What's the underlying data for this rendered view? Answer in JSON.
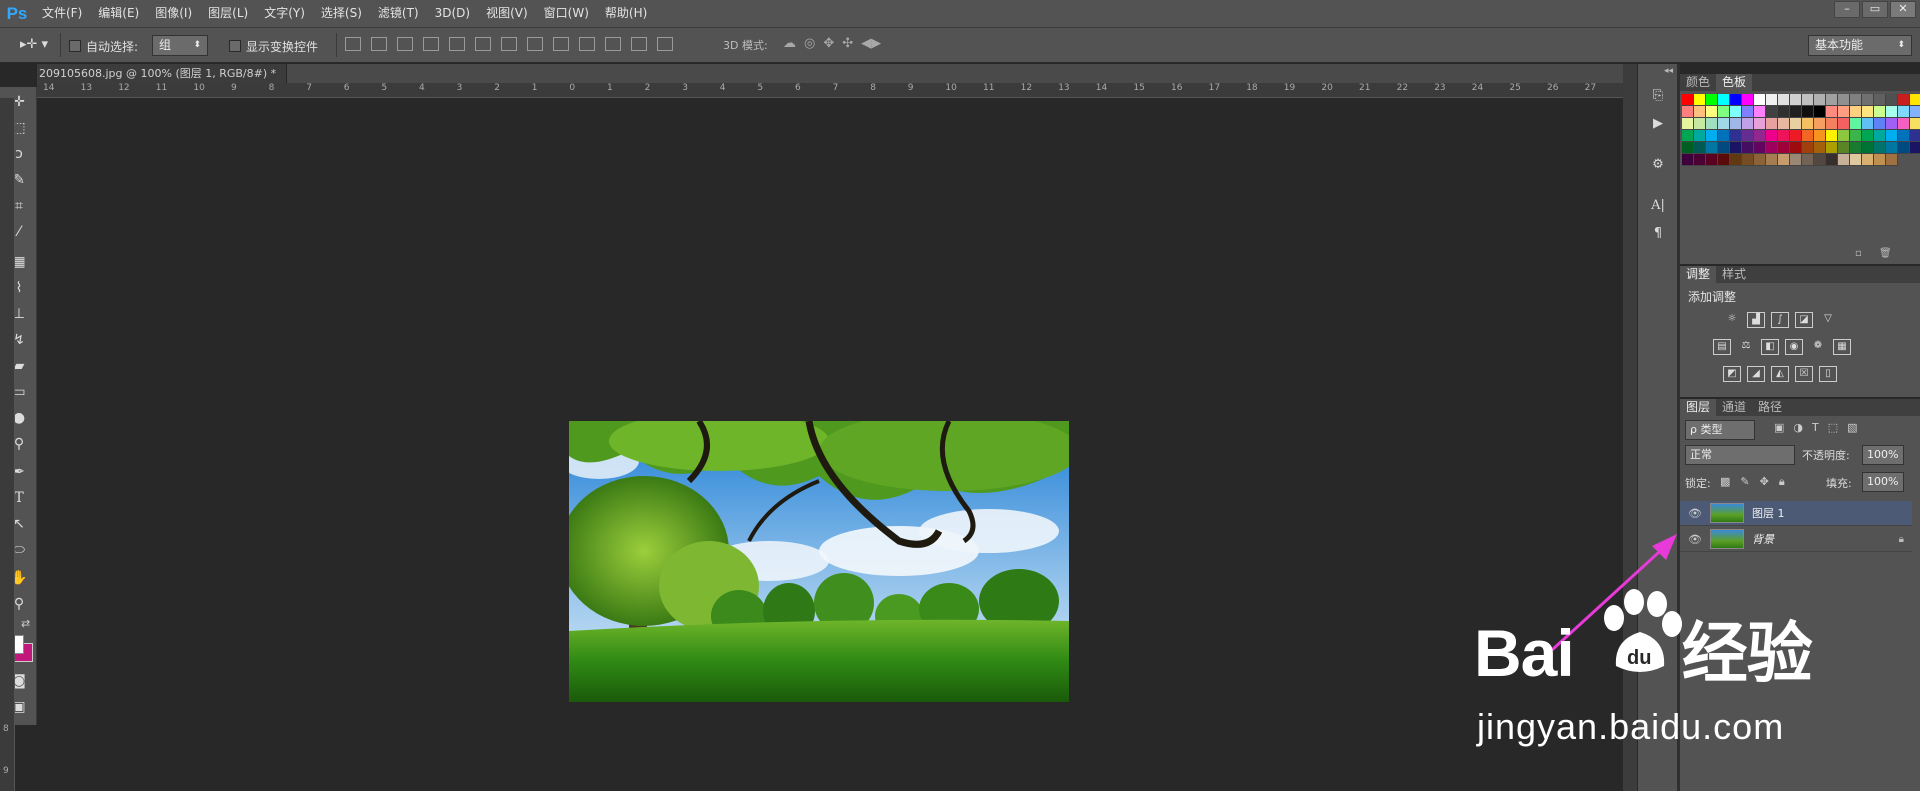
{
  "app": {
    "logo": "Ps"
  },
  "menu": [
    "文件(F)",
    "编辑(E)",
    "图像(I)",
    "图层(L)",
    "文字(Y)",
    "选择(S)",
    "滤镜(T)",
    "3D(D)",
    "视图(V)",
    "窗口(W)",
    "帮助(H)"
  ],
  "window_controls": [
    "–",
    "▭",
    "✕"
  ],
  "options": {
    "auto_select_label": "自动选择:",
    "auto_select_value": "组",
    "show_transform_label": "显示变换控件",
    "mode_3d_label": "3D 模式:",
    "workspace": "基本功能"
  },
  "document": {
    "tab_title": "209105608.jpg @ 100% (图层 1, RGB/8#) *",
    "tab_close": "×"
  },
  "ruler": {
    "h_labels": [
      "14",
      "13",
      "12",
      "11",
      "10",
      "9",
      "8",
      "7",
      "6",
      "5",
      "4",
      "3",
      "2",
      "1",
      "0",
      "1",
      "2",
      "3",
      "4",
      "5",
      "6",
      "7",
      "8",
      "9",
      "10",
      "11",
      "12",
      "13",
      "14",
      "15",
      "16",
      "17",
      "18",
      "19",
      "20",
      "21",
      "22",
      "23",
      "24",
      "25",
      "26",
      "27"
    ],
    "v_labels": [
      "8",
      "9"
    ]
  },
  "panels": {
    "color_tabs": [
      "颜色",
      "色板"
    ],
    "adjust_tabs": [
      "调整",
      "样式"
    ],
    "add_adjustment": "添加调整",
    "layers_tabs": [
      "图层",
      "通道",
      "路径"
    ],
    "filter_kind": "ρ 类型",
    "blend_mode": "正常",
    "opacity_label": "不透明度:",
    "opacity_value": "100%",
    "lock_label": "锁定:",
    "fill_label": "填充:",
    "fill_value": "100%",
    "layers": [
      {
        "name": "图层 1",
        "selected": true,
        "locked": false
      },
      {
        "name": "背景",
        "selected": false,
        "locked": true
      }
    ]
  },
  "swatches": [
    "#ff0000",
    "#ffff00",
    "#00ff00",
    "#00ffff",
    "#0000ff",
    "#ff00ff",
    "#ffffff",
    "#f0f0f0",
    "#e0e0e0",
    "#d0d0d0",
    "#c0c0c0",
    "#b0b0b0",
    "#a0a0a0",
    "#909090",
    "#808080",
    "#707070",
    "#606060",
    "#505050",
    "#c81e1e",
    "#ffe600",
    "#ffe600",
    "#ff7f7f",
    "#ffbf7f",
    "#ffff7f",
    "#7fff7f",
    "#7fffff",
    "#7f7fff",
    "#ff7fff",
    "#404040",
    "#303030",
    "#202020",
    "#101010",
    "#000000",
    "#ff8a80",
    "#ff9e80",
    "#ffd180",
    "#ffe57f",
    "#ccff90",
    "#a7ffeb",
    "#80d8ff",
    "#82b1ff",
    "#b388ff",
    "#e8f5a0",
    "#c6e8a0",
    "#a0e0c0",
    "#a0d8e8",
    "#a0b8e8",
    "#c0a0e8",
    "#e8a0d8",
    "#e8a0a0",
    "#e8b8a0",
    "#e8d0a0",
    "#f5c060",
    "#f5a060",
    "#f58060",
    "#f56060",
    "#60f5a0",
    "#60c0f5",
    "#6080f5",
    "#a060f5",
    "#f560c0",
    "#f5e060",
    "#c0f560",
    "#00a651",
    "#00a99d",
    "#00aeef",
    "#0072bc",
    "#2e3192",
    "#662d91",
    "#92278f",
    "#ec008c",
    "#ed145b",
    "#ed1c24",
    "#f26522",
    "#f7941d",
    "#fff200",
    "#8dc63f",
    "#39b54a",
    "#00a651",
    "#00a99d",
    "#00aeef",
    "#0072bc",
    "#2e3192",
    "#662d91",
    "#005e20",
    "#005952",
    "#0076a3",
    "#004a80",
    "#1b1464",
    "#440e62",
    "#630460",
    "#9e005d",
    "#9e0039",
    "#9e0b0f",
    "#a0410d",
    "#a36209",
    "#aba000",
    "#598527",
    "#197b30",
    "#007236",
    "#00746b",
    "#0076a3",
    "#004a80",
    "#1b1464",
    "#440e62",
    "#3d003d",
    "#4a0033",
    "#5a0020",
    "#5a0a0a",
    "#603913",
    "#754c24",
    "#8c6239",
    "#a67c52",
    "#c69c6d",
    "#998675",
    "#736357",
    "#534741",
    "#362f2d",
    "#c7b299",
    "#e0c89e",
    "#d8b070",
    "#c09050",
    "#a07040"
  ]
}
